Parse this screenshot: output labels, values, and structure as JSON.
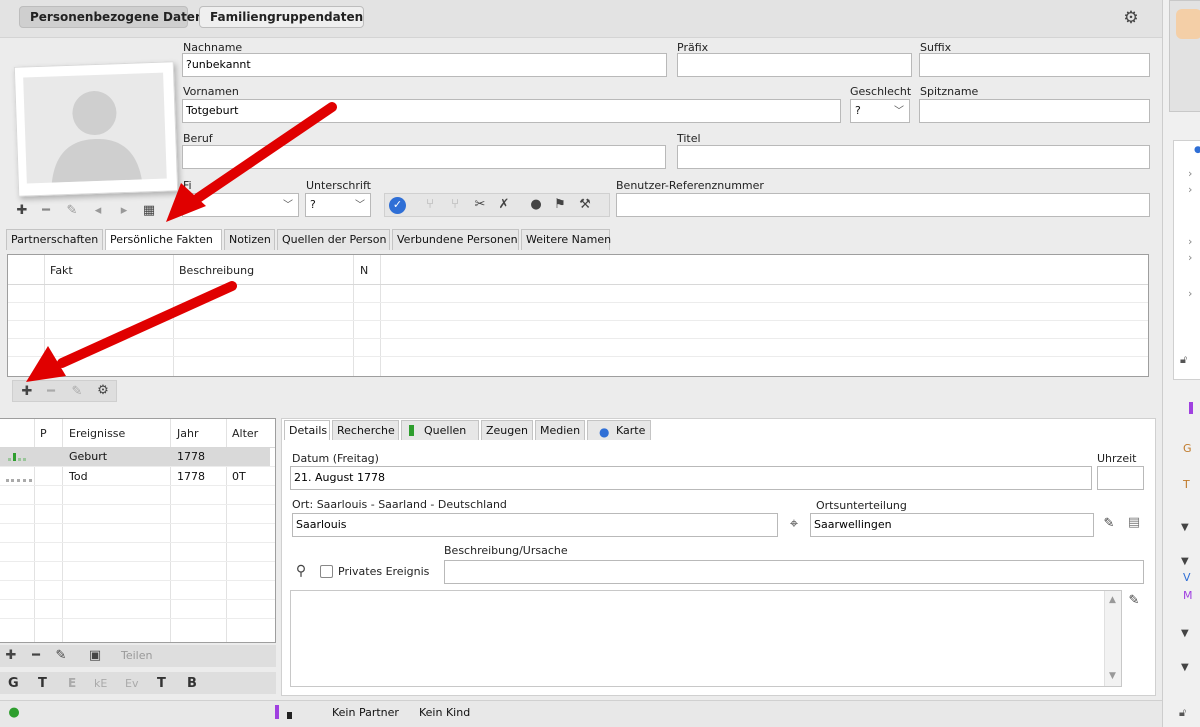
{
  "top_tabs": [
    "Personenbezogene Daten",
    "Familiengruppendaten"
  ],
  "labels": {
    "nachname": "Nachname",
    "praefix": "Präfix",
    "suffix": "Suffix",
    "vornamen": "Vornamen",
    "geschlecht": "Geschlecht",
    "spitzname": "Spitzname",
    "beruf": "Beruf",
    "titel": "Titel",
    "fi": "Fi",
    "unterschrift": "Unterschrift",
    "benutzer_ref": "Benutzer-Referenznummer"
  },
  "values": {
    "nachname": "?unbekannt",
    "praefix": "",
    "suffix": "",
    "vornamen": "Totgeburt",
    "geschlecht": "?",
    "spitzname": "",
    "beruf": "",
    "titel": "",
    "unterschrift": "?",
    "benutzer_ref": ""
  },
  "person_tabs": [
    "Partnerschaften",
    "Persönliche Fakten",
    "Notizen",
    "Quellen der Person",
    "Verbundene Personen",
    "Weitere Namen"
  ],
  "facts_table": {
    "headers": [
      "Fakt",
      "Beschreibung",
      "N"
    ]
  },
  "events_table": {
    "headers": [
      "P",
      "Ereignisse",
      "Jahr",
      "Alter"
    ],
    "rows": [
      {
        "event": "Geburt",
        "year": "1778",
        "age": ""
      },
      {
        "event": "Tod",
        "year": "1778",
        "age": "0T"
      }
    ]
  },
  "event_toolbar": {
    "share": "Teilen"
  },
  "event_letters": [
    "G",
    "T",
    "E",
    "kE",
    "Ev",
    "T",
    "B"
  ],
  "detail_tabs": [
    "Details",
    "Recherche",
    "Quellen",
    "Zeugen",
    "Medien",
    "Karte"
  ],
  "details": {
    "datum_label": "Datum (Freitag)",
    "datum_value": "21. August 1778",
    "uhrzeit_label": "Uhrzeit",
    "uhrzeit_value": "",
    "ort_label": "Ort: Saarlouis - Saarland - Deutschland",
    "ort_value": "Saarlouis",
    "ortsunterteilung_label": "Ortsunterteilung",
    "ortsunterteilung_value": "Saarwellingen",
    "beschreibung_label": "Beschreibung/Ursache",
    "beschreibung_value": "",
    "privat_label": "Privates Ereignis"
  },
  "status": {
    "partner": "Kein Partner",
    "kind": "Kein Kind"
  },
  "right_strip_letters": [
    "G",
    "T",
    "V",
    "M"
  ],
  "colors": {
    "arrow": "#e00000",
    "accent_blue": "#2f6fd6",
    "green_bar": "#2e9e2e",
    "purple": "#a040e0"
  }
}
